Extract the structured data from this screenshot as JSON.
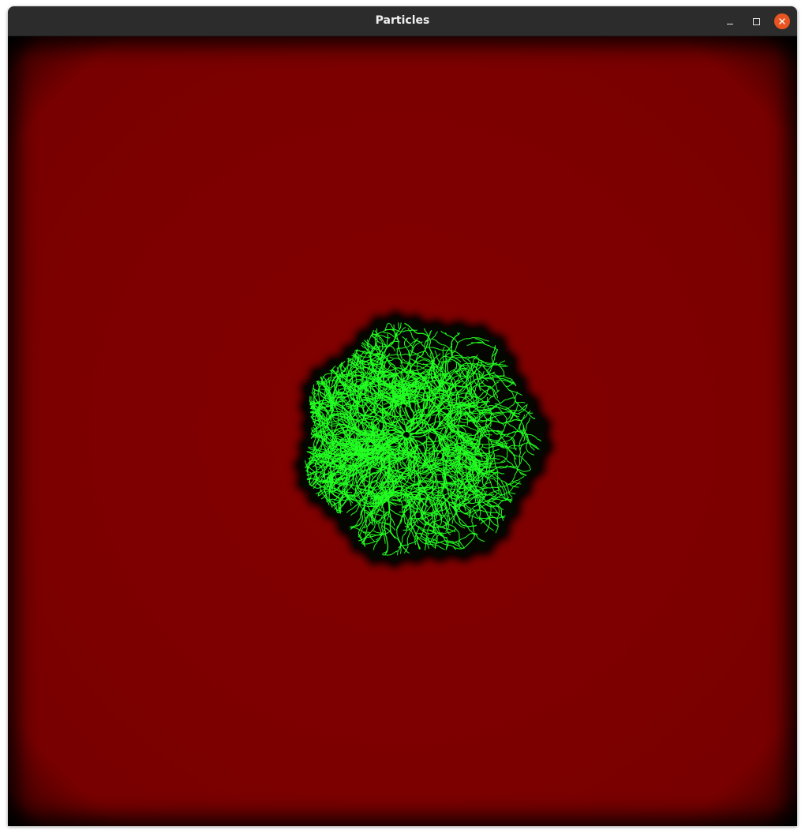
{
  "window": {
    "title": "Particles"
  },
  "controls": {
    "minimize": "minimize-icon",
    "maximize": "maximize-icon",
    "close": "close-icon"
  },
  "colors": {
    "titlebar": "#2c2c2c",
    "close_button": "#e95420",
    "field": "#800000",
    "cluster_halo": "#000000",
    "particles": "#22ff22"
  }
}
